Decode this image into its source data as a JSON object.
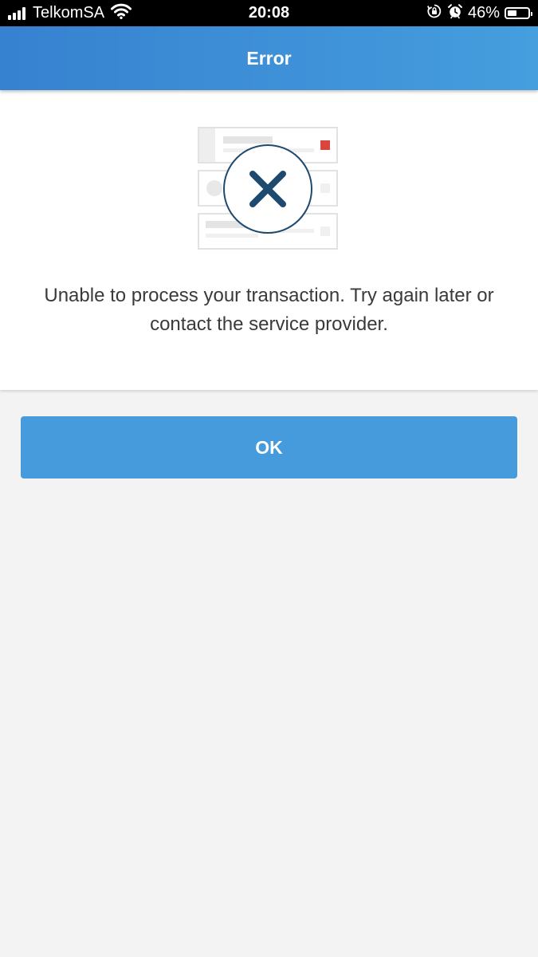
{
  "status_bar": {
    "carrier": "TelkomSA",
    "time": "20:08",
    "battery_percent": "46%",
    "battery_level": 0.46,
    "signal_strength_bars": 4,
    "icons": [
      "signal-icon",
      "wifi-icon",
      "orientation-lock-icon",
      "alarm-icon",
      "battery-icon"
    ]
  },
  "header": {
    "title": "Error"
  },
  "error": {
    "icon": "error-x-icon",
    "message": "Unable to process your transaction. Try again later or contact the service provider."
  },
  "actions": {
    "ok_label": "OK"
  },
  "colors": {
    "header_gradient_start": "#3681d0",
    "header_gradient_end": "#459ede",
    "button": "#459bdb",
    "x_mark": "#1f4a70",
    "accent_red": "#d9443f",
    "background": "#f3f3f3"
  }
}
